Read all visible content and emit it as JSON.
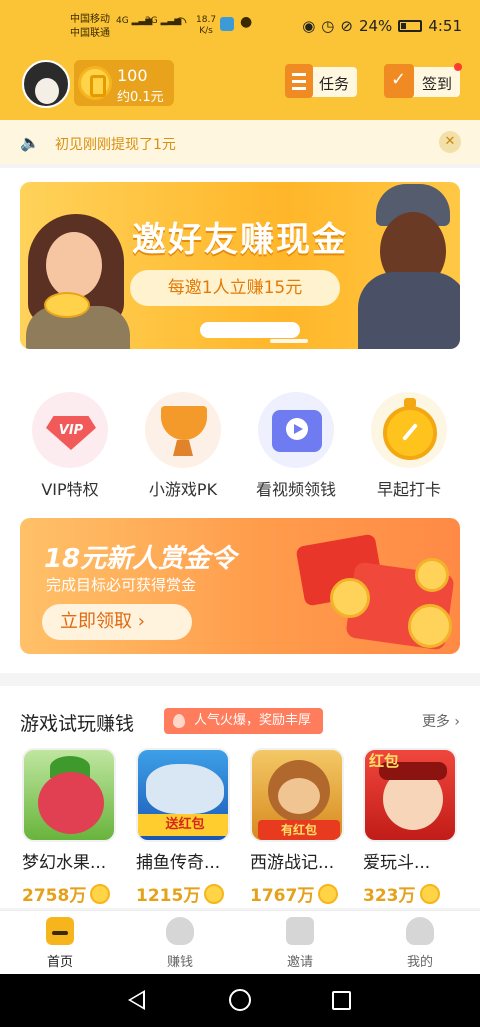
{
  "status_bar": {
    "carrier_1": "中国移动",
    "carrier_2": "中国联通",
    "net_1": "4G",
    "net_2": "3G",
    "speed_value": "18.7",
    "speed_unit": "K/s",
    "battery": "24%",
    "time": "4:51"
  },
  "header": {
    "coin_count": "100",
    "coin_approx": "约0.1元",
    "task_label": "任务",
    "sign_label": "签到"
  },
  "notice": {
    "text": "初见刚刚提现了1元"
  },
  "invite_banner": {
    "title": "邀好友赚现金",
    "subtitle": "每邀1人立赚15元"
  },
  "features": [
    {
      "label": "VIP特权",
      "icon": "vip-gem-icon",
      "badge": "VIP"
    },
    {
      "label": "小游戏PK",
      "icon": "trophy-icon"
    },
    {
      "label": "看视频领钱",
      "icon": "video-play-icon"
    },
    {
      "label": "早起打卡",
      "icon": "stopwatch-icon"
    }
  ],
  "bounty_banner": {
    "title": "18元新人赏金令",
    "subtitle": "完成目标必可获得赏金",
    "cta": "立即领取 ›"
  },
  "games_section": {
    "title": "游戏试玩赚钱",
    "tag": "人气火爆，奖励丰厚",
    "more": "更多 ›",
    "items": [
      {
        "name": "梦幻水果...",
        "count": "2758万",
        "badge": ""
      },
      {
        "name": "捕鱼传奇...",
        "count": "1215万",
        "badge": "送红包"
      },
      {
        "name": "西游战记...",
        "count": "1767万",
        "badge": "有红包"
      },
      {
        "name": "爱玩斗...",
        "count": "323万",
        "badge": "红包"
      }
    ]
  },
  "tabbar": {
    "items": [
      {
        "label": "首页",
        "icon": "home-icon",
        "active": true
      },
      {
        "label": "赚钱",
        "icon": "money-bag-icon",
        "active": false
      },
      {
        "label": "邀请",
        "icon": "invite-icon",
        "active": false
      },
      {
        "label": "我的",
        "icon": "profile-icon",
        "active": false
      }
    ]
  },
  "colors": {
    "brand_yellow": "#fbc437",
    "accent_orange": "#f08a22",
    "coin_gold": "#e5a11a"
  }
}
